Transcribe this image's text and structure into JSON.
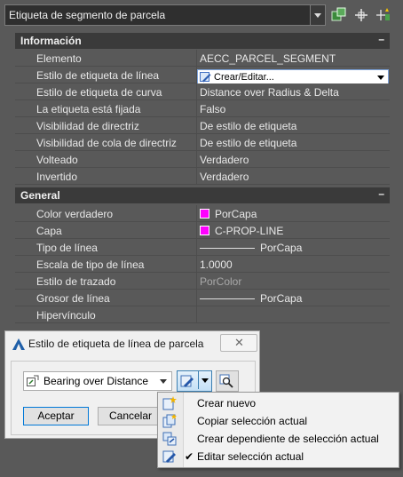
{
  "top_select": {
    "value": "Etiqueta de segmento de parcela"
  },
  "toolbar": {
    "icons": [
      "select-objects-icon",
      "pick-add-icon",
      "quick-select-icon"
    ]
  },
  "sections": {
    "info": {
      "title": "Información",
      "collapse": "–"
    },
    "general": {
      "title": "General",
      "collapse": "–"
    }
  },
  "info_rows": [
    {
      "key": "Elemento",
      "value": "AECC_PARCEL_SEGMENT"
    },
    {
      "key": "Estilo de etiqueta de línea",
      "value": "Crear/Editar..."
    },
    {
      "key": "Estilo de etiqueta de curva",
      "value": "Distance over Radius & Delta"
    },
    {
      "key": "La etiqueta está fijada",
      "value": "Falso"
    },
    {
      "key": "Visibilidad de directriz",
      "value": "De estilo de etiqueta"
    },
    {
      "key": "Visibilidad de cola de directriz",
      "value": "De estilo de etiqueta"
    },
    {
      "key": "Volteado",
      "value": "Verdadero"
    },
    {
      "key": "Invertido",
      "value": "Verdadero"
    }
  ],
  "general_rows": [
    {
      "key": "Color verdadero",
      "value": "PorCapa"
    },
    {
      "key": "Capa",
      "value": "C-PROP-LINE"
    },
    {
      "key": "Tipo de línea",
      "value": "PorCapa"
    },
    {
      "key": "Escala de tipo de línea",
      "value": "1.0000"
    },
    {
      "key": "Estilo de trazado",
      "value": "PorColor"
    },
    {
      "key": "Grosor de línea",
      "value": "PorCapa"
    },
    {
      "key": "Hipervínculo",
      "value": ""
    }
  ],
  "colors": {
    "swatch": "#ff00ff",
    "accent": "#0078d7"
  },
  "dialog": {
    "title": "Estilo de etiqueta de línea de parcela",
    "close": "✕",
    "style_value": "Bearing over Distance",
    "accept": "Aceptar",
    "cancel": "Cancelar"
  },
  "menu": {
    "items": [
      {
        "label": "Crear nuevo",
        "icon": "create-new-icon",
        "checked": ""
      },
      {
        "label": "Copiar selección actual",
        "icon": "copy-selection-icon",
        "checked": ""
      },
      {
        "label": "Crear dependiente de selección actual",
        "icon": "create-child-icon",
        "checked": ""
      },
      {
        "label": "Editar selección actual",
        "icon": "edit-selection-icon",
        "checked": "✔"
      }
    ]
  }
}
